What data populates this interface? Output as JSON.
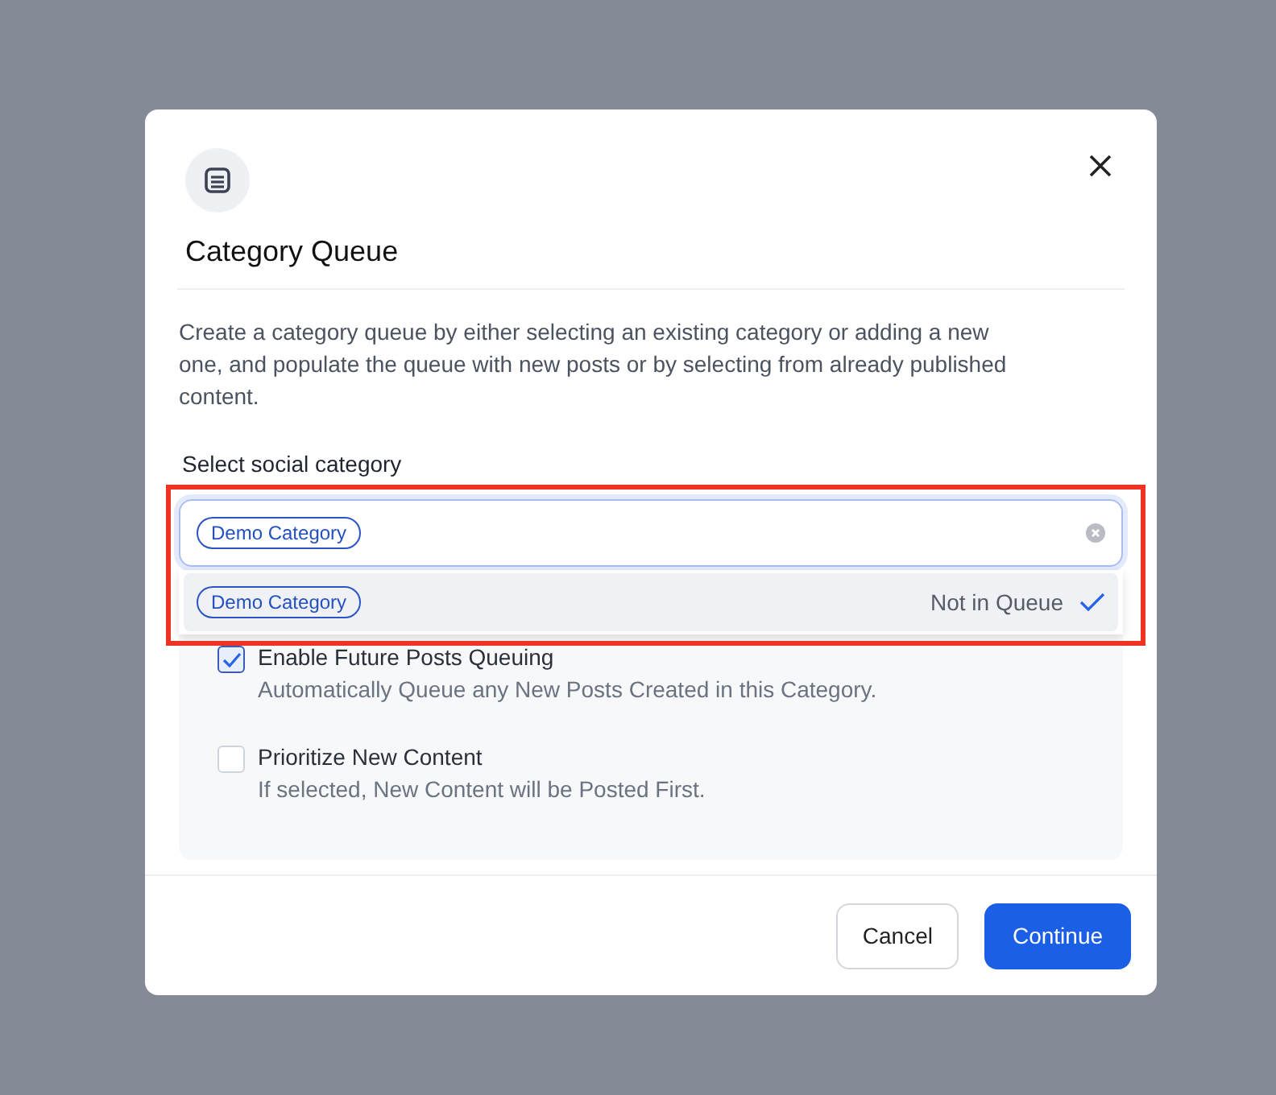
{
  "dialog": {
    "title": "Category Queue",
    "description": "Create a category queue by either selecting an existing category or adding a new one, and populate the queue with new posts or by selecting from already published content.",
    "field_label": "Select social category",
    "select": {
      "chips": [
        "Demo Category"
      ],
      "highlighted": true
    },
    "dropdown": [
      {
        "chip": "Demo Category",
        "status": "Not in Queue",
        "selected": true
      }
    ],
    "options": [
      {
        "label": "Enable Future Posts Queuing",
        "hint": "Automatically Queue any New Posts Created in this Category.",
        "checked": true
      },
      {
        "label": "Prioritize New Content",
        "hint": "If selected, New Content will be Posted First.",
        "checked": false
      }
    ],
    "buttons": [
      {
        "label": "Cancel",
        "kind": "secondary"
      },
      {
        "label": "Continue",
        "kind": "primary"
      }
    ]
  }
}
